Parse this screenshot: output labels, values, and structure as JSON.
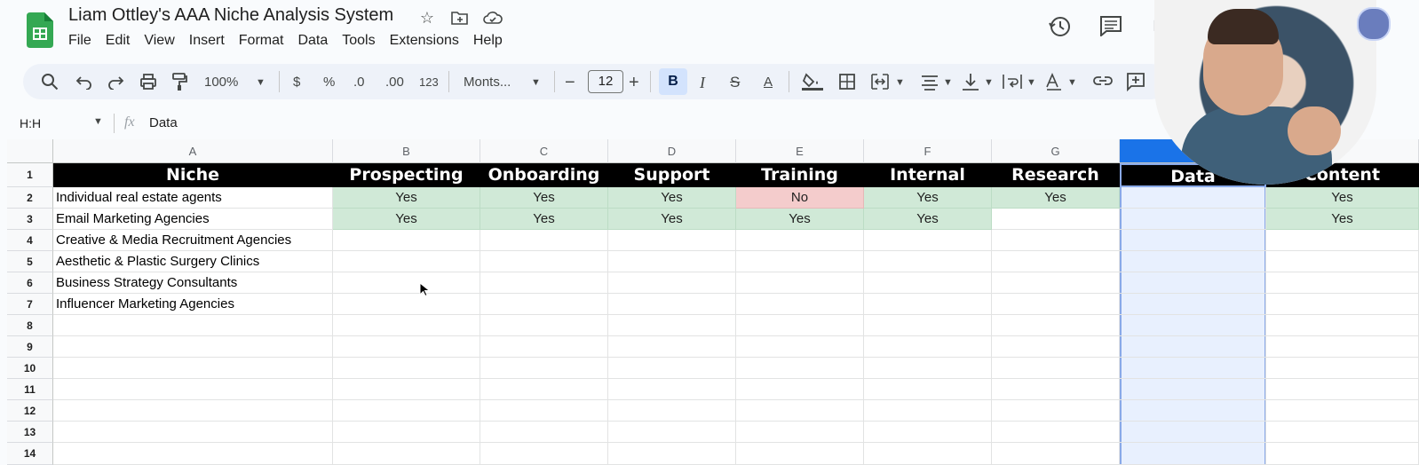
{
  "app": {
    "title": "Liam Ottley's AAA Niche Analysis System",
    "menu": [
      "File",
      "Edit",
      "View",
      "Insert",
      "Format",
      "Data",
      "Tools",
      "Extensions",
      "Help"
    ]
  },
  "toolbar": {
    "zoom": "100%",
    "currency": "$",
    "percent": "%",
    "decrease_decimal": ".0",
    "increase_decimal": ".00",
    "number_format": "123",
    "font": "Monts...",
    "font_size": "12",
    "bold": "B",
    "italic": "I",
    "text_color": "A"
  },
  "formula_bar": {
    "name_box": "H:H",
    "fx": "fx",
    "value": "Data"
  },
  "grid": {
    "columns": [
      "A",
      "B",
      "C",
      "D",
      "E",
      "F",
      "G",
      "",
      ""
    ],
    "rows": [
      "1",
      "2",
      "3",
      "4",
      "5",
      "6",
      "7",
      "8",
      "9",
      "10",
      "11",
      "12",
      "13",
      "14"
    ],
    "headers": [
      "Niche",
      "Prospecting",
      "Onboarding",
      "Support",
      "Training",
      "Internal",
      "Research",
      "Data",
      "Content"
    ],
    "data_rows": [
      [
        "Individual real estate agents",
        "Yes",
        "Yes",
        "Yes",
        "No",
        "Yes",
        "Yes",
        "",
        "Yes"
      ],
      [
        "Email Marketing Agencies",
        "Yes",
        "Yes",
        "Yes",
        "Yes",
        "Yes",
        "",
        "",
        "Yes"
      ],
      [
        "Creative & Media Recruitment Agencies",
        "",
        "",
        "",
        "",
        "",
        "",
        "",
        ""
      ],
      [
        "Aesthetic & Plastic Surgery Clinics",
        "",
        "",
        "",
        "",
        "",
        "",
        "",
        ""
      ],
      [
        "Business Strategy Consultants",
        "",
        "",
        "",
        "",
        "",
        "",
        "",
        ""
      ],
      [
        "Influencer Marketing Agencies",
        "",
        "",
        "",
        "",
        "",
        "",
        "",
        ""
      ]
    ]
  },
  "colors": {
    "yes_fill": "#d0e9d7",
    "no_fill": "#f4cccc",
    "header_fill": "#000000",
    "selected_column": "#e8f0fe"
  }
}
